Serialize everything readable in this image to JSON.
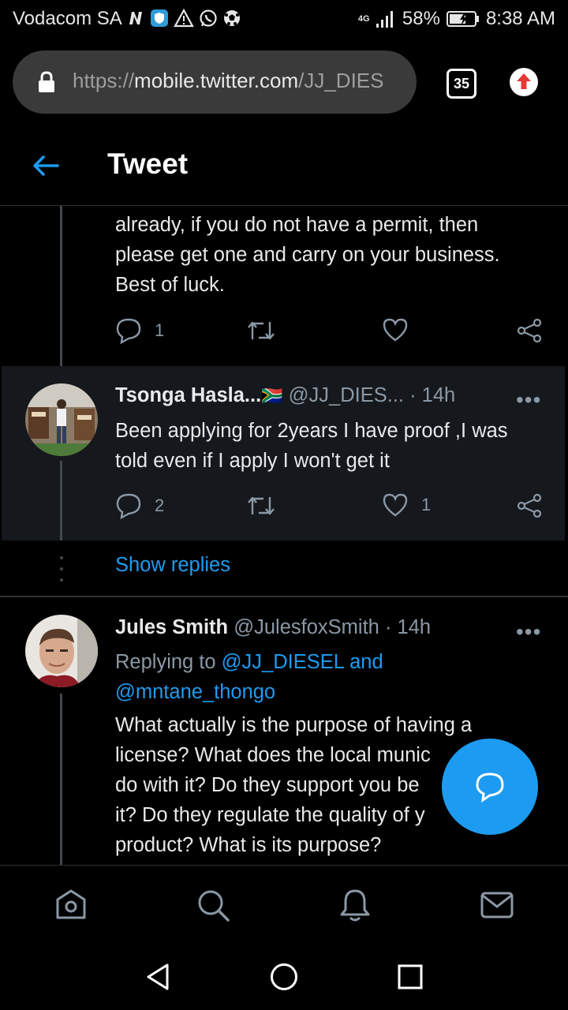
{
  "status_bar": {
    "carrier": "Vodacom SA",
    "network": "4G",
    "battery": "58%",
    "time": "8:38 AM"
  },
  "browser": {
    "url_scheme": "https://",
    "url_host": "mobile.twitter.com",
    "url_path": "/JJ_DIES",
    "tab_count": "35"
  },
  "header": {
    "title": "Tweet"
  },
  "tweets": [
    {
      "text_lines": [
        "already, if you do not have a permit, then",
        "please get one and carry on your business.",
        "Best of luck."
      ],
      "reply_count": "1",
      "like_count": ""
    },
    {
      "name": "Tsonga Hasla...",
      "flag": "🇿🇦",
      "handle": "@JJ_DIES...",
      "time": "· 14h",
      "text_lines": [
        "Been applying for 2years I have proof ,I was",
        "told even if I apply I won't get it"
      ],
      "reply_count": "2",
      "like_count": "1"
    },
    {
      "name": "Jules Smith",
      "handle": "@JulesfoxSmith",
      "time": "· 14h",
      "replying_prefix": "Replying to",
      "replying_to_1": "@JJ_DIESEL and",
      "replying_to_2": "@mntane_thongo",
      "text_lines": [
        "What actually is the purpose of having a",
        "license? What does the local munic",
        "do with it? Do they support you be",
        "it? Do they regulate the quality of y",
        "product? What is its purpose?"
      ]
    }
  ],
  "show_replies": "Show replies",
  "more_glyph": "•••",
  "colors": {
    "accent": "#1d9bf0",
    "background": "#000000",
    "highlight": "#15181c",
    "muted": "#8b98a5"
  },
  "icons": {
    "bottom_nav": [
      "home-icon",
      "search-icon",
      "notifications-icon",
      "messages-icon"
    ],
    "system_nav": [
      "back-triangle-icon",
      "home-circle-icon",
      "recents-square-icon"
    ]
  }
}
